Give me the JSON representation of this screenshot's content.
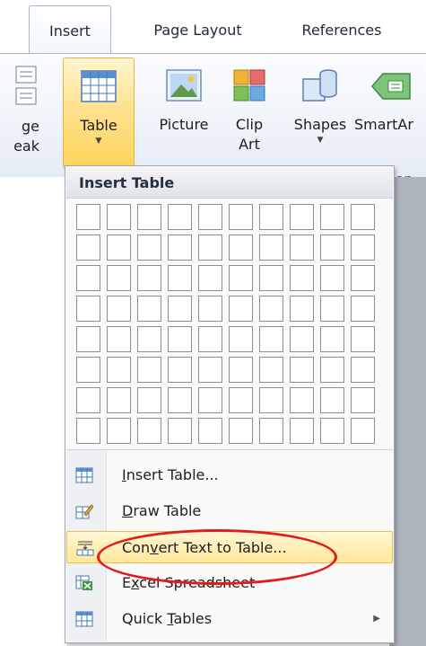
{
  "tabs": [
    {
      "label": "Insert",
      "active": true
    },
    {
      "label": "Page Layout",
      "active": false
    },
    {
      "label": "References",
      "active": false
    }
  ],
  "ribbon": {
    "page_break": {
      "line1": "ge",
      "line2": "eak"
    },
    "table": {
      "label": "Table"
    },
    "picture": {
      "label": "Picture"
    },
    "clip_art": {
      "line1": "Clip",
      "line2": "Art"
    },
    "shapes": {
      "label": "Shapes"
    },
    "smartart": {
      "label": "SmartAr"
    },
    "group_label_partial": "ion"
  },
  "dropdown": {
    "header": "Insert Table",
    "grid": {
      "columns": 10,
      "rows": 8
    },
    "items": [
      {
        "pre": "",
        "key": "I",
        "post": "nsert Table...",
        "icon": "insert-table-icon"
      },
      {
        "pre": "",
        "key": "D",
        "post": "raw Table",
        "icon": "draw-table-icon"
      },
      {
        "pre": "Con",
        "key": "v",
        "post": "ert Text to Table...",
        "icon": "convert-text-icon",
        "highlighted": true
      },
      {
        "pre": "E",
        "key": "x",
        "post": "cel Spreadsheet",
        "icon": "excel-icon"
      },
      {
        "pre": "Quick ",
        "key": "T",
        "post": "ables",
        "icon": "quick-tables-icon",
        "submenu": true
      }
    ]
  },
  "colors": {
    "highlight": "#ffe89a",
    "annotation_oval": "#e21b1b",
    "ribbon_border": "#a7b7cd"
  }
}
